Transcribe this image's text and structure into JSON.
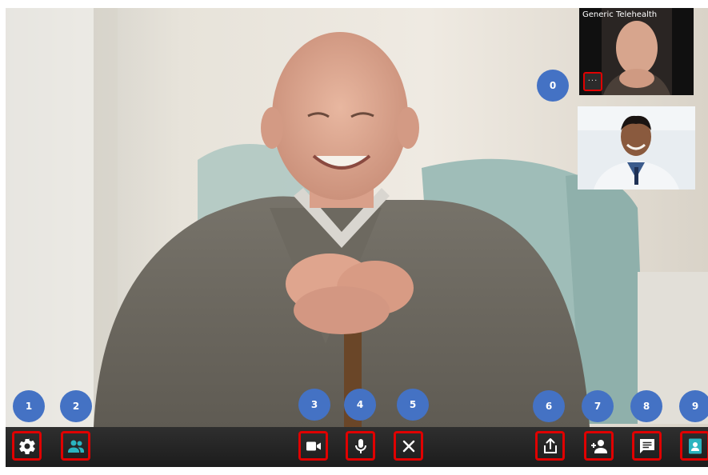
{
  "window": {
    "label": "Generic Telehealth"
  },
  "thumbnails": {
    "self_view": {
      "label": "Generic Telehealth",
      "more_glyph": "···",
      "more_icon": "more-horizontal-icon"
    },
    "doctor_view": {
      "icon": "person-video-icon"
    }
  },
  "badges": [
    "0",
    "1",
    "2",
    "3",
    "4",
    "5",
    "6",
    "7",
    "8",
    "9"
  ],
  "toolbar": {
    "items": [
      {
        "icon": "gear-icon",
        "color": "#ffffff"
      },
      {
        "icon": "participants-icon",
        "color": "#2bb5c0"
      },
      {
        "icon": "video-camera-icon",
        "color": "#ffffff"
      },
      {
        "icon": "microphone-icon",
        "color": "#ffffff"
      },
      {
        "icon": "close-icon",
        "color": "#ffffff"
      },
      {
        "icon": "share-icon",
        "color": "#ffffff"
      },
      {
        "icon": "add-person-icon",
        "color": "#ffffff"
      },
      {
        "icon": "chat-icon",
        "color": "#ffffff"
      },
      {
        "icon": "contact-card-icon",
        "color": "#2bb5c0"
      }
    ]
  },
  "colors": {
    "annotation_outline": "#e00000",
    "badge": "#4472c4",
    "accent_teal": "#2bb5c0",
    "toolbar_bg": "#262626"
  }
}
